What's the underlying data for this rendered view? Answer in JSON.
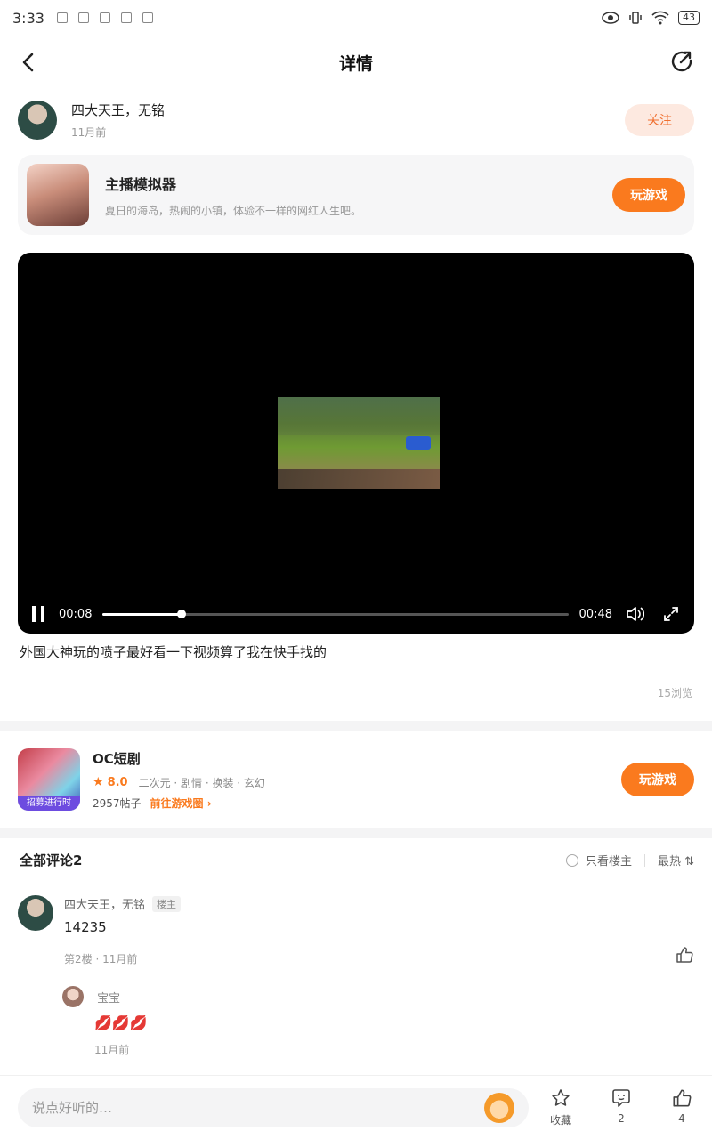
{
  "status_bar": {
    "time": "3:33",
    "battery": "43"
  },
  "header": {
    "title": "详情"
  },
  "author": {
    "name": "四大天王，无铭",
    "time": "11月前",
    "follow_label": "关注"
  },
  "game_card": {
    "name": "主播模拟器",
    "desc": "夏日的海岛，热闹的小镇，体验不一样的网红人生吧。",
    "play_label": "玩游戏"
  },
  "video": {
    "current_time": "00:08",
    "duration": "00:48",
    "progress": 0.17
  },
  "post": {
    "caption": "外国大神玩的喷子最好看一下视频算了我在快手找的",
    "views": "15浏览"
  },
  "game_row": {
    "name": "OC短剧",
    "rating": "8.0",
    "tags": "二次元 · 剧情 · 换装 · 玄幻",
    "posts": "2957帖子",
    "goto_label": "前往游戏圈 ›",
    "ribbon": "招募进行时",
    "play_label": "玩游戏"
  },
  "comments_header": {
    "title": "全部评论2",
    "only_owner": "只看楼主",
    "sort": "最热 ⇅"
  },
  "comment": {
    "name": "四大天王，无铭",
    "tag": "楼主",
    "text": "14235",
    "meta": "第2楼 · 11月前"
  },
  "reply": {
    "name": "宝宝",
    "text": "💋💋💋",
    "time": "11月前"
  },
  "bottom_bar": {
    "placeholder": "说点好听的…",
    "fav_label": "收藏",
    "comment_count": "2",
    "like_count": "4"
  },
  "colors": {
    "accent": "#fa7a1e",
    "follow_bg": "#fde9e0"
  }
}
